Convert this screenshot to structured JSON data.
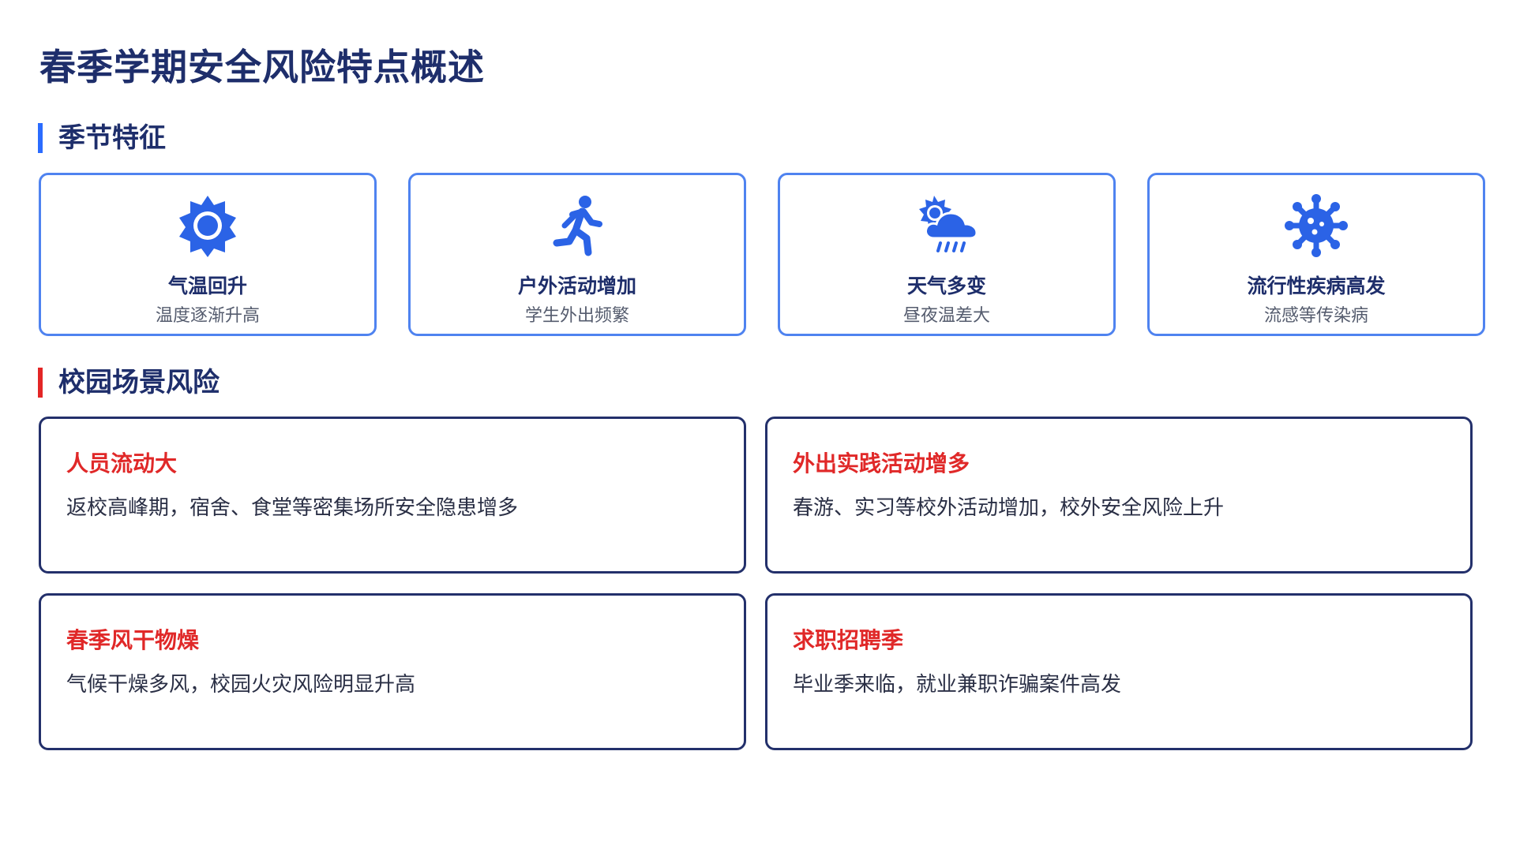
{
  "title": "春季学期安全风险特点概述",
  "sections": {
    "season": {
      "label": "季节特征",
      "accent": "#2b6cff"
    },
    "campus": {
      "label": "校园场景风险",
      "accent": "#e32626"
    }
  },
  "features": [
    {
      "icon": "sun-gear-icon",
      "title": "气温回升",
      "subtitle": "温度逐渐升高"
    },
    {
      "icon": "running-person-icon",
      "title": "户外活动增加",
      "subtitle": "学生外出频繁"
    },
    {
      "icon": "sun-cloud-rain-icon",
      "title": "天气多变",
      "subtitle": "昼夜温差大"
    },
    {
      "icon": "virus-icon",
      "title": "流行性疾病高发",
      "subtitle": "流感等传染病"
    }
  ],
  "risks": [
    {
      "title": "人员流动大",
      "description": "返校高峰期，宿舍、食堂等密集场所安全隐患增多"
    },
    {
      "title": "外出实践活动增多",
      "description": "春游、实习等校外活动增加，校外安全风险上升"
    },
    {
      "title": "春季风干物燥",
      "description": "气候干燥多风，校园火灾风险明显升高"
    },
    {
      "title": "求职招聘季",
      "description": "毕业季来临，就业兼职诈骗案件高发"
    }
  ],
  "colors": {
    "primary_dark": "#1e2e6b",
    "card_border_blue": "#4f83f0",
    "icon_blue": "#2b63e6",
    "risk_title_red": "#e02828"
  }
}
